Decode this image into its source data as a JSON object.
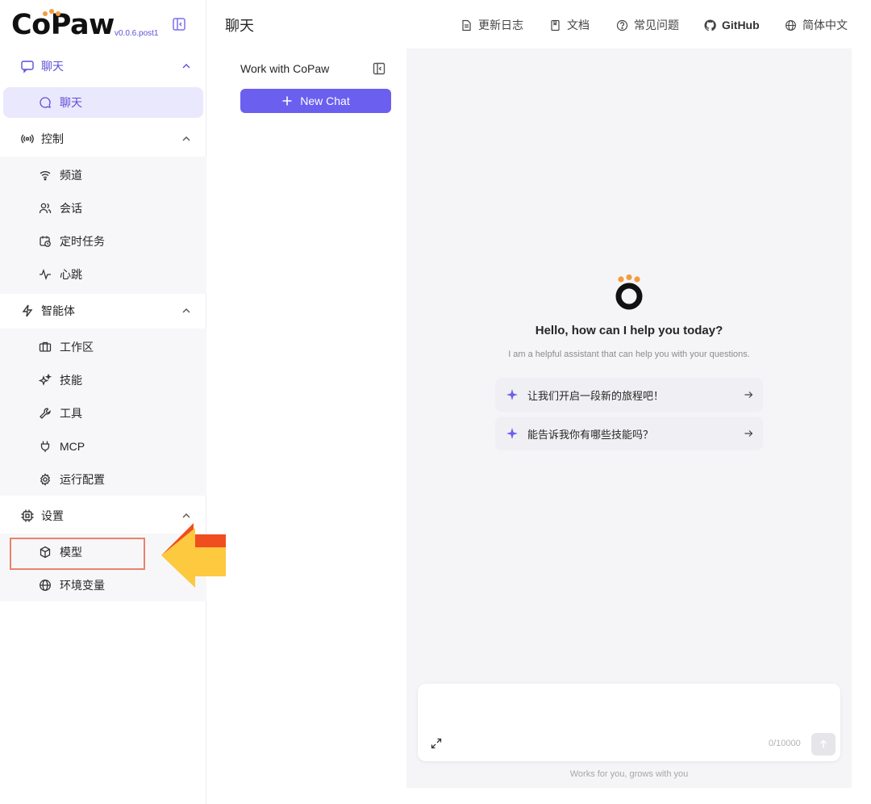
{
  "brand": {
    "name": "CoPaw",
    "version": "v0.0.6.post1"
  },
  "sidebar": {
    "groups": [
      {
        "label": "聊天",
        "icon": "chat-bubble-icon",
        "items": [
          {
            "label": "聊天",
            "icon": "chat-circle-icon"
          }
        ]
      },
      {
        "label": "控制",
        "icon": "broadcast-icon",
        "items": [
          {
            "label": "频道",
            "icon": "wifi-icon"
          },
          {
            "label": "会话",
            "icon": "users-icon"
          },
          {
            "label": "定时任务",
            "icon": "calendar-clock-icon"
          },
          {
            "label": "心跳",
            "icon": "heartbeat-icon"
          }
        ]
      },
      {
        "label": "智能体",
        "icon": "lightning-icon",
        "items": [
          {
            "label": "工作区",
            "icon": "briefcase-icon"
          },
          {
            "label": "技能",
            "icon": "sparkles-icon"
          },
          {
            "label": "工具",
            "icon": "wrench-icon"
          },
          {
            "label": "MCP",
            "icon": "plug-icon"
          },
          {
            "label": "运行配置",
            "icon": "gear-icon"
          }
        ]
      },
      {
        "label": "设置",
        "icon": "chip-icon",
        "items": [
          {
            "label": "模型",
            "icon": "cube-icon"
          },
          {
            "label": "环境变量",
            "icon": "globe-icon"
          }
        ]
      }
    ]
  },
  "header": {
    "title": "聊天",
    "links": [
      {
        "label": "更新日志",
        "icon": "document-icon"
      },
      {
        "label": "文档",
        "icon": "book-icon"
      },
      {
        "label": "常见问题",
        "icon": "help-circle-icon"
      },
      {
        "label": "GitHub",
        "icon": "github-icon"
      },
      {
        "label": "简体中文",
        "icon": "globe-icon"
      }
    ]
  },
  "chat_list": {
    "title": "Work with CoPaw",
    "new_chat_label": "New Chat"
  },
  "welcome": {
    "title": "Hello, how can I help you today?",
    "subtitle": "I am a helpful assistant that can help you with your questions.",
    "prompts": [
      "让我们开启一段新的旅程吧！",
      "能告诉我你有哪些技能吗？"
    ]
  },
  "composer": {
    "value": "",
    "char_count": "0/10000",
    "footer": "Works for you, grows with you"
  },
  "colors": {
    "accent": "#6b5ff0",
    "highlight_border": "#e8826a",
    "arrow_fill": "#fcc93f",
    "arrow_edge": "#f04e1f",
    "logo_dots": "#f39c3c"
  }
}
